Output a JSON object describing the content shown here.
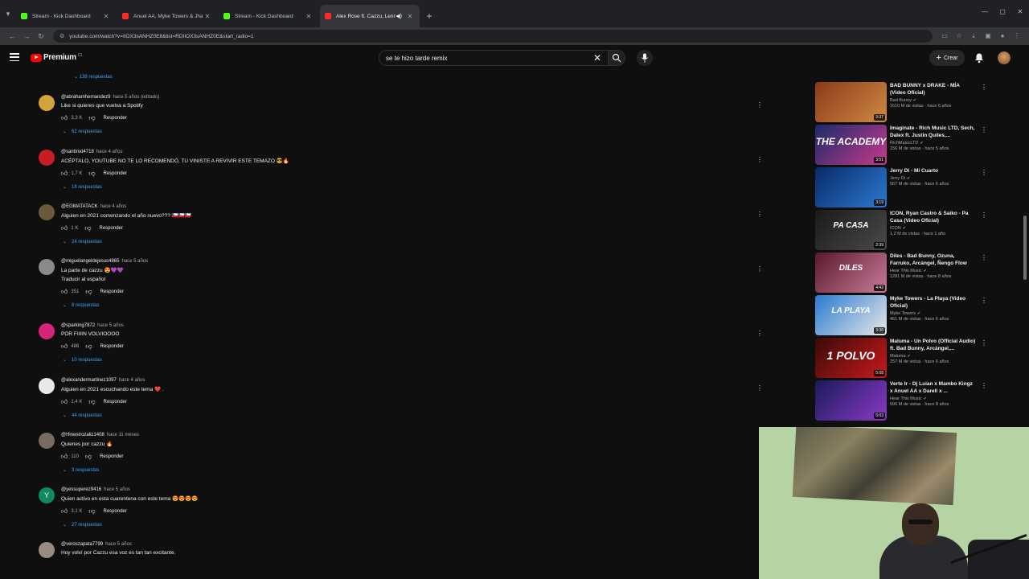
{
  "browser": {
    "tabs": [
      {
        "title": "Stream - Kick Dashboard",
        "favicon": "kick",
        "active": false,
        "audio": false
      },
      {
        "title": "Anuel AA, Myke Towers & Jhay...",
        "favicon": "youtube",
        "active": false,
        "audio": false
      },
      {
        "title": "Stream - Kick Dashboard",
        "favicon": "kick",
        "active": false,
        "audio": false
      },
      {
        "title": "Alex Rose ft. Cazzu, Lenny T...",
        "favicon": "youtube",
        "active": true,
        "audio": true
      }
    ],
    "url": "youtube.com/watch?v=IIOX3sANHZ0E8&list=RDIIOX3sANHZ0E&start_radio=1"
  },
  "youtube": {
    "logo_text": "Premium",
    "logo_country": "CL",
    "search_query": "se te hizo tarde remix",
    "create_label": "Crear",
    "accent_color": "#ff0000",
    "link_color": "#3ea6ff"
  },
  "comments": {
    "prev_replies": "138 respuestas",
    "items": [
      {
        "author": "@abrahamhernandez9",
        "time": "hace 5 años (editado)",
        "text": "Like si quieres que vuelva a Spotify",
        "text2": "",
        "likes": "3,3 K",
        "reply_label": "Responder",
        "replies": "62 respuestas",
        "avatar_color": "#d4a23a"
      },
      {
        "author": "@santirod4718",
        "time": "hace 4 años",
        "text": "ACÉPTALO, YOUTUBE NO TE LO RECOMENDÓ, TU VINISTE A REVIVIR ESTE TEMAZO 😎🔥",
        "text2": "",
        "likes": "1,7 K",
        "reply_label": "Responder",
        "replies": "18 respuestas",
        "avatar_color": "#c81d25"
      },
      {
        "author": "@EGMATATACK",
        "time": "hace 4 años",
        "text": "Alguien en 2021 comenzando el año nuevo??? 🇨🇱🇨🇱🇨🇱",
        "text2": "",
        "likes": "1 K",
        "reply_label": "Responder",
        "replies": "24 respuestas",
        "avatar_color": "#6b5a3a"
      },
      {
        "author": "@miguelangeldejesus4865",
        "time": "hace 5 años",
        "text": "La parte de cazzu 😍💜💜",
        "text2": "Traducir al español",
        "likes": "351",
        "reply_label": "Responder",
        "replies": "8 respuestas",
        "avatar_color": "#8a8a8a"
      },
      {
        "author": "@sparking7872",
        "time": "hace 5 años",
        "text": "POR FIIIIN VOLVIOOOO",
        "text2": "",
        "likes": "486",
        "reply_label": "Responder",
        "replies": "10 respuestas",
        "avatar_color": "#d6247a"
      },
      {
        "author": "@alexandermartinez1097",
        "time": "hace 4 años",
        "text": "Alguien en 2021 escuchando este tema ❤️ .",
        "text2": "",
        "likes": "1,4 K",
        "reply_label": "Responder",
        "replies": "44 respuestas",
        "avatar_color": "#e8e8e8"
      },
      {
        "author": "@Hinestrozaliz1408",
        "time": "hace 11 meses",
        "text": "Quienes por cazzu 🔥",
        "text2": "",
        "likes": "110",
        "reply_label": "Responder",
        "replies": "3 respuestas",
        "avatar_color": "#7a6a60"
      },
      {
        "author": "@yessuperez9416",
        "time": "hace 5 años",
        "text": "Quien activo en esta cuarentena con este tema 😍😍😍😍",
        "text2": "",
        "likes": "3,1 K",
        "reply_label": "Responder",
        "replies": "27 respuestas",
        "avatar_color": "#0f8a5f",
        "avatar_letter": "Y"
      },
      {
        "author": "@veroszapata7799",
        "time": "hace 5 años",
        "text": "Hoy volví por Cazzu esa voz es tan tan excitante.",
        "text2": "",
        "likes": "",
        "reply_label": "",
        "replies": "",
        "avatar_color": "#9a8a80"
      }
    ]
  },
  "sidebar": {
    "items": [
      {
        "title": "BAD BUNNY x DRAKE - MÍA (Video Oficial)",
        "channel": "Bad Bunny",
        "stats": "1610 M de vistas · hace 6 años",
        "duration": "3:37",
        "thumb": [
          "#8a3a1a",
          "#d08a40"
        ],
        "label": ""
      },
      {
        "title": "Imaginate - Rich Music LTD, Sech, Dalex ft. Justin Quiles,...",
        "channel": "RichMusicLTD",
        "stats": "156 M de vistas · hace 5 años",
        "duration": "3:51",
        "thumb": [
          "#1a2a6a",
          "#c83a8a"
        ],
        "label": "THE ACADEMY"
      },
      {
        "title": "Jerry Di - Mi Cuarto",
        "channel": "Jerry Di",
        "stats": "567 M de vistas · hace 6 años",
        "duration": "3:19",
        "thumb": [
          "#0a2a6a",
          "#2a7ad0"
        ],
        "label": ""
      },
      {
        "title": "ICON, Ryan Castro & Saiko - Pa Casa (Video Oficial)",
        "channel": "ICON",
        "stats": "1,2 M de vistas · hace 1 año",
        "duration": "2:39",
        "thumb": [
          "#1a1a1a",
          "#4a4a4a"
        ],
        "label": "PA CASA"
      },
      {
        "title": "Diles - Bad Bunny, Ozuna, Farruko, Arcángel, Ñengo Flow",
        "channel": "Hear This Music",
        "stats": "1281 M de vistas · hace 8 años",
        "duration": "4:42",
        "thumb": [
          "#5a1a2a",
          "#c87a9a"
        ],
        "label": "DILES"
      },
      {
        "title": "Myke Towers - La Playa (Video Oficial)",
        "channel": "Myke Towers",
        "stats": "461 M de vistas · hace 6 años",
        "duration": "3:38",
        "thumb": [
          "#2a7ad0",
          "#e8e8e8"
        ],
        "label": "LA PLAYA"
      },
      {
        "title": "Maluma - Un Polvo (Official Audio) ft. Bad Bunny, Arcángel,...",
        "channel": "Maluma",
        "stats": "257 M de vistas · hace 6 años",
        "duration": "5:08",
        "thumb": [
          "#3a0a0a",
          "#c81a1a"
        ],
        "label": "1 POLVO"
      },
      {
        "title": "Verte Ir - Dj Luian x Mambo Kingz x Anuel AA x Darell x ...",
        "channel": "Hear This Music",
        "stats": "596 M de vistas · hace 8 años",
        "duration": "5:03",
        "thumb": [
          "#1a1a5a",
          "#8a3ac8"
        ],
        "label": ""
      }
    ]
  }
}
